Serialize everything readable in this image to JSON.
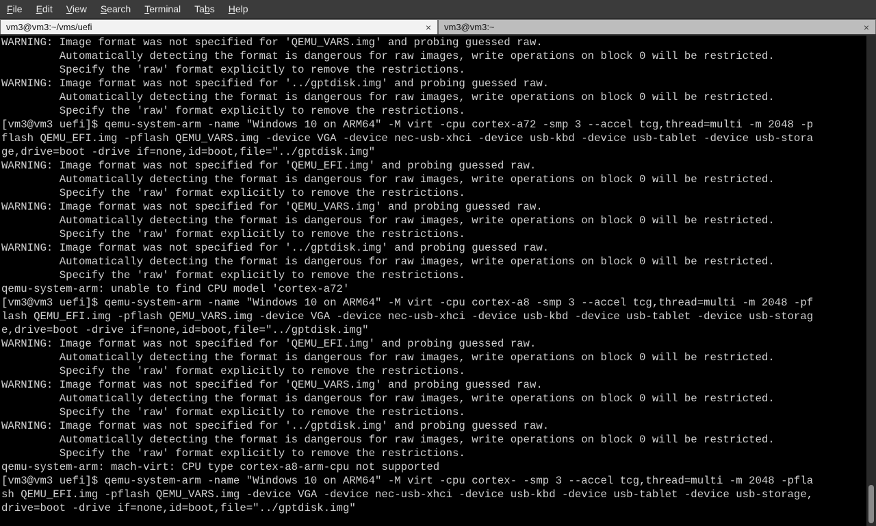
{
  "menubar": {
    "items": [
      {
        "mnemonic": "F",
        "rest": "ile"
      },
      {
        "mnemonic": "E",
        "rest": "dit"
      },
      {
        "mnemonic": "V",
        "rest": "iew"
      },
      {
        "mnemonic": "S",
        "rest": "earch"
      },
      {
        "mnemonic": "T",
        "rest": "erminal"
      },
      {
        "prefix": "Ta",
        "mnemonic": "b",
        "rest": "s"
      },
      {
        "mnemonic": "H",
        "rest": "elp"
      }
    ]
  },
  "tabs": [
    {
      "title": "vm3@vm3:~/vms/uefi",
      "close": "×"
    },
    {
      "title": "vm3@vm3:~",
      "close": "×"
    }
  ],
  "terminal": {
    "lines": [
      "WARNING: Image format was not specified for 'QEMU_VARS.img' and probing guessed raw.",
      "         Automatically detecting the format is dangerous for raw images, write operations on block 0 will be restricted.",
      "         Specify the 'raw' format explicitly to remove the restrictions.",
      "WARNING: Image format was not specified for '../gptdisk.img' and probing guessed raw.",
      "         Automatically detecting the format is dangerous for raw images, write operations on block 0 will be restricted.",
      "         Specify the 'raw' format explicitly to remove the restrictions.",
      "[vm3@vm3 uefi]$ qemu-system-arm -name \"Windows 10 on ARM64\" -M virt -cpu cortex-a72 -smp 3 --accel tcg,thread=multi -m 2048 -p",
      "flash QEMU_EFI.img -pflash QEMU_VARS.img -device VGA -device nec-usb-xhci -device usb-kbd -device usb-tablet -device usb-stora",
      "ge,drive=boot -drive if=none,id=boot,file=\"../gptdisk.img\"",
      "WARNING: Image format was not specified for 'QEMU_EFI.img' and probing guessed raw.",
      "         Automatically detecting the format is dangerous for raw images, write operations on block 0 will be restricted.",
      "         Specify the 'raw' format explicitly to remove the restrictions.",
      "WARNING: Image format was not specified for 'QEMU_VARS.img' and probing guessed raw.",
      "         Automatically detecting the format is dangerous for raw images, write operations on block 0 will be restricted.",
      "         Specify the 'raw' format explicitly to remove the restrictions.",
      "WARNING: Image format was not specified for '../gptdisk.img' and probing guessed raw.",
      "         Automatically detecting the format is dangerous for raw images, write operations on block 0 will be restricted.",
      "         Specify the 'raw' format explicitly to remove the restrictions.",
      "qemu-system-arm: unable to find CPU model 'cortex-a72'",
      "[vm3@vm3 uefi]$ qemu-system-arm -name \"Windows 10 on ARM64\" -M virt -cpu cortex-a8 -smp 3 --accel tcg,thread=multi -m 2048 -pf",
      "lash QEMU_EFI.img -pflash QEMU_VARS.img -device VGA -device nec-usb-xhci -device usb-kbd -device usb-tablet -device usb-storag",
      "e,drive=boot -drive if=none,id=boot,file=\"../gptdisk.img\"",
      "WARNING: Image format was not specified for 'QEMU_EFI.img' and probing guessed raw.",
      "         Automatically detecting the format is dangerous for raw images, write operations on block 0 will be restricted.",
      "         Specify the 'raw' format explicitly to remove the restrictions.",
      "WARNING: Image format was not specified for 'QEMU_VARS.img' and probing guessed raw.",
      "         Automatically detecting the format is dangerous for raw images, write operations on block 0 will be restricted.",
      "         Specify the 'raw' format explicitly to remove the restrictions.",
      "WARNING: Image format was not specified for '../gptdisk.img' and probing guessed raw.",
      "         Automatically detecting the format is dangerous for raw images, write operations on block 0 will be restricted.",
      "         Specify the 'raw' format explicitly to remove the restrictions.",
      "qemu-system-arm: mach-virt: CPU type cortex-a8-arm-cpu not supported",
      "[vm3@vm3 uefi]$ qemu-system-arm -name \"Windows 10 on ARM64\" -M virt -cpu cortex- -smp 3 --accel tcg,thread=multi -m 2048 -pfla",
      "sh QEMU_EFI.img -pflash QEMU_VARS.img -device VGA -device nec-usb-xhci -device usb-kbd -device usb-tablet -device usb-storage,",
      "drive=boot -drive if=none,id=boot,file=\"../gptdisk.img\""
    ]
  }
}
